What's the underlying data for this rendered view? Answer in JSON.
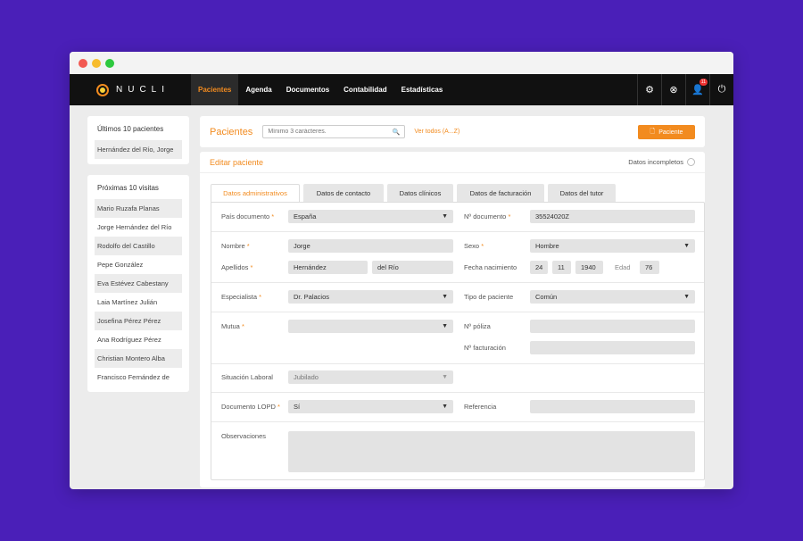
{
  "app": {
    "logo_text": "NUCLI"
  },
  "nav": {
    "items": [
      {
        "label": "Pacientes",
        "active": true
      },
      {
        "label": "Agenda"
      },
      {
        "label": "Documentos"
      },
      {
        "label": "Contabilidad"
      },
      {
        "label": "Estadísticas"
      }
    ],
    "icons": [
      "gear-icon",
      "close-circle-icon",
      "user-icon",
      "power-icon"
    ],
    "notification_count": "11"
  },
  "sidebar": {
    "recent_title": "Últimos 10 pacientes",
    "recent": [
      "Hernández del Río, Jorge"
    ],
    "upcoming_title": "Próximas 10 visitas",
    "upcoming": [
      "Mario Ruzafa Planas",
      "Jorge Hernández del Río",
      "Rodolfo del Castillo",
      "Pepe González",
      "Eva Estévez Cabestany",
      "Laia Martínez Julián",
      "Josefina Pérez Pérez",
      "Ana Rodríguez Pérez",
      "Christian Montero Alba",
      "Francisco Fernández de"
    ]
  },
  "header": {
    "title": "Pacientes",
    "search_placeholder": "Mínimo 3 carácteres.",
    "see_all": "Ver todos (A...Z)",
    "add_label": "Paciente"
  },
  "edit": {
    "title": "Editar paciente",
    "incomplete_label": "Datos incompletos",
    "tabs": [
      "Datos administrativos",
      "Datos de contacto",
      "Datos clínicos",
      "Datos de facturación",
      "Datos del tutor"
    ]
  },
  "form": {
    "pais_label": "País documento",
    "pais_value": "España",
    "doc_label": "Nº documento",
    "doc_value": "35524020Z",
    "nombre_label": "Nombre",
    "nombre_value": "Jorge",
    "sexo_label": "Sexo",
    "sexo_value": "Hombre",
    "apellidos_label": "Apellidos",
    "apellido1": "Hernández",
    "apellido2": "del Río",
    "nacimiento_label": "Fecha nacimiento",
    "dia": "24",
    "mes": "11",
    "anio": "1940",
    "edad_label": "Edad",
    "edad_value": "76",
    "especialista_label": "Especialista",
    "especialista_value": "Dr. Palacios",
    "tipo_label": "Tipo de paciente",
    "tipo_value": "Común",
    "mutua_label": "Mutua",
    "mutua_value": "",
    "poliza_label": "Nº póliza",
    "poliza_value": "",
    "facturacion_label": "Nº facturación",
    "facturacion_value": "",
    "laboral_label": "Situación Laboral",
    "laboral_value": "Jubilado",
    "lopd_label": "Documento LOPD",
    "lopd_value": "Sí",
    "referencia_label": "Referencia",
    "referencia_value": "",
    "observaciones_label": "Observaciones",
    "observaciones_value": "",
    "required_mark": "*"
  }
}
